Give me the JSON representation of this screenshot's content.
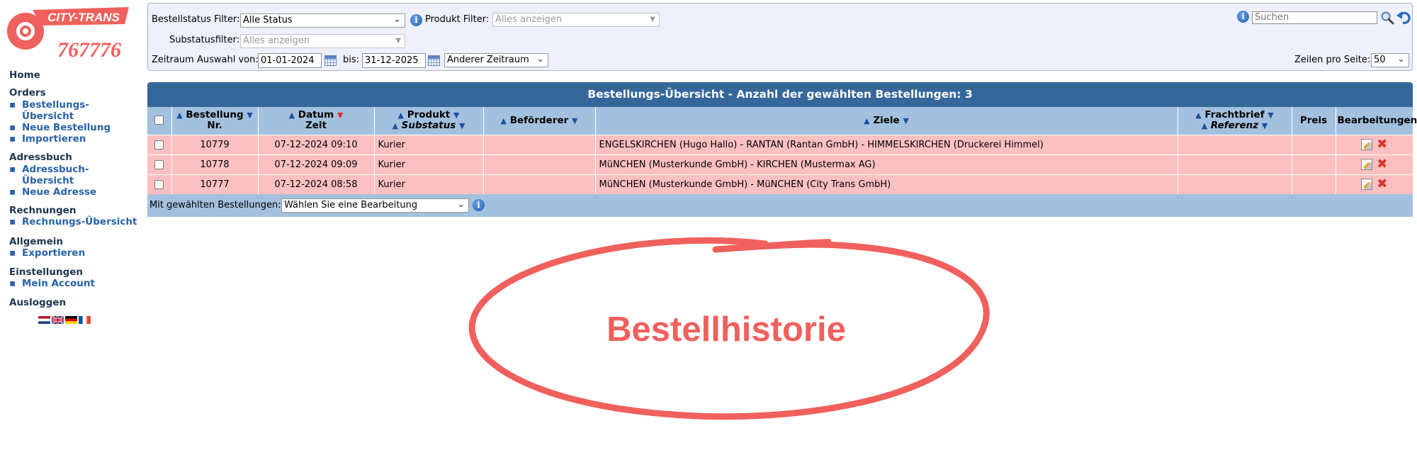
{
  "logo": {
    "brand": "CITY-TRANS",
    "phone": "767776"
  },
  "sidebar": {
    "home": "Home",
    "sections": [
      {
        "title": "Orders",
        "items": [
          "Bestellungs-",
          "Übersicht",
          "Neue Bestellung",
          "Importieren"
        ]
      },
      {
        "title": "Adressbuch",
        "items": [
          "Adressbuch-",
          "Übersicht",
          "Neue Adresse"
        ]
      },
      {
        "title": "Rechnungen",
        "items": [
          "Rechnungs-Übersicht"
        ]
      },
      {
        "title": "Allgemein",
        "items": [
          "Exportieren"
        ]
      },
      {
        "title": "Einstellungen",
        "items": [
          "Mein Account"
        ]
      }
    ],
    "logout": "Ausloggen",
    "languages": [
      "nl",
      "en",
      "de",
      "fr"
    ]
  },
  "filters": {
    "status_label": "Bestellstatus Filter:",
    "status_value": "Alle Status",
    "product_label": "Produkt Filter:",
    "product_placeholder": "Alles anzeigen",
    "substatus_label": "Substatusfilter:",
    "substatus_placeholder": "Alles anzeigen",
    "period_label": "Zeitraum Auswahl von:",
    "date_from": "01-01-2024",
    "to_label": "bis:",
    "date_to": "31-12-2025",
    "period_select": "Anderer Zeitraum",
    "search_placeholder": "Suchen",
    "rows_label": "Zeilen pro Seite:",
    "rows_value": "50"
  },
  "table": {
    "title": "Bestellungs-Übersicht - Anzahl der gewählten Bestellungen: 3",
    "headers": {
      "order_nr_1": "Bestellung",
      "order_nr_2": "Nr.",
      "date_1": "Datum",
      "date_2": "Zeit",
      "product_1": "Produkt",
      "product_2": "Substatus",
      "carrier": "Beförderer",
      "destinations": "Ziele",
      "waybill_1": "Frachtbrief",
      "waybill_2": "Referenz",
      "price": "Preis",
      "actions": "Bearbeitungen"
    },
    "rows": [
      {
        "nr": "10779",
        "datetime": "07-12-2024 09:10",
        "product": "Kurier",
        "carrier": "",
        "destinations": "ENGELSKIRCHEN (Hugo Hallo) - RANTAN (Rantan GmbH) - HIMMELSKIRCHEN (Druckerei Himmel)",
        "waybill": "",
        "price": ""
      },
      {
        "nr": "10778",
        "datetime": "07-12-2024 09:09",
        "product": "Kurier",
        "carrier": "",
        "destinations": "MüNCHEN (Musterkunde GmbH) - KIRCHEN (Mustermax AG)",
        "waybill": "",
        "price": ""
      },
      {
        "nr": "10777",
        "datetime": "07-12-2024 08:58",
        "product": "Kurier",
        "carrier": "",
        "destinations": "MüNCHEN (Musterkunde GmbH) - MüNCHEN (City Trans GmbH)",
        "waybill": "",
        "price": ""
      }
    ],
    "bulk_label": "Mit gewählten Bestellungen:",
    "bulk_select": "Wählen Sie eine Bearbeitung"
  },
  "annotation": {
    "text": "Bestellhistorie",
    "color": "#f0605c"
  },
  "colors": {
    "header_blue": "#35679b",
    "column_header": "#a3c1df",
    "row_pink": "#fdc0c0",
    "panel_bg": "#eef0fc",
    "link_blue": "#2763a8"
  }
}
